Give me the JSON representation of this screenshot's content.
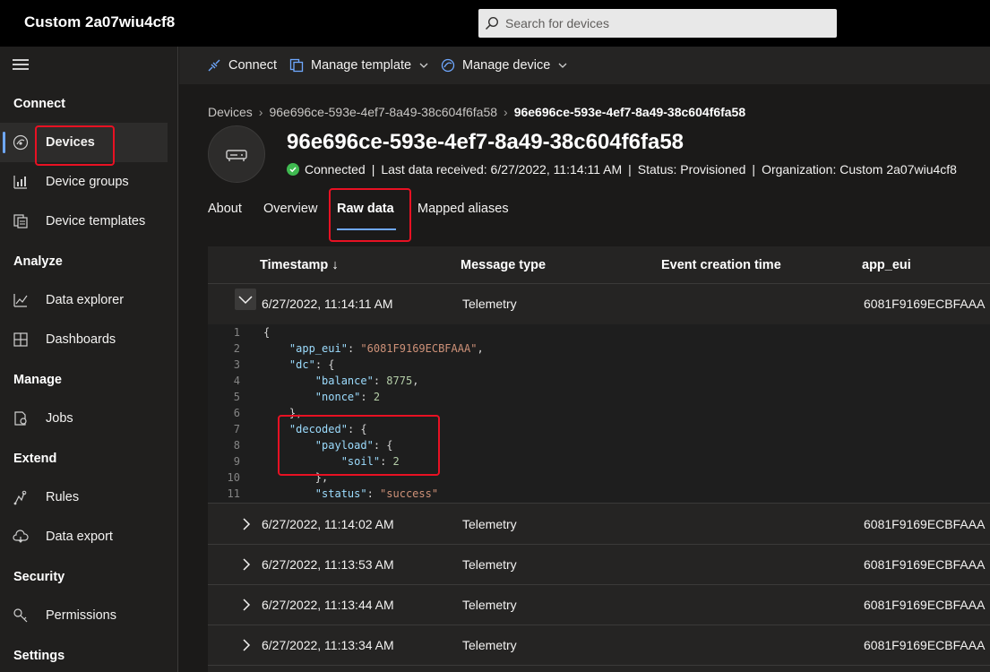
{
  "app": {
    "title": "Custom 2a07wiu4cf8"
  },
  "search": {
    "placeholder": "Search for devices"
  },
  "sidebar": {
    "sections": [
      {
        "label": "Connect"
      },
      {
        "label": "Analyze"
      },
      {
        "label": "Manage"
      },
      {
        "label": "Extend"
      },
      {
        "label": "Security"
      },
      {
        "label": "Settings"
      }
    ],
    "items": [
      {
        "label": "Devices"
      },
      {
        "label": "Device groups"
      },
      {
        "label": "Device templates"
      },
      {
        "label": "Data explorer"
      },
      {
        "label": "Dashboards"
      },
      {
        "label": "Jobs"
      },
      {
        "label": "Rules"
      },
      {
        "label": "Data export"
      },
      {
        "label": "Permissions"
      }
    ]
  },
  "commands": {
    "connect": "Connect",
    "manage_template": "Manage template",
    "manage_device": "Manage device"
  },
  "breadcrumb": {
    "root": "Devices",
    "parent": "96e696ce-593e-4ef7-8a49-38c604f6fa58",
    "current": "96e696ce-593e-4ef7-8a49-38c604f6fa58"
  },
  "device": {
    "title": "96e696ce-593e-4ef7-8a49-38c604f6fa58",
    "connection": "Connected",
    "last_data": "Last data received: 6/27/2022, 11:14:11 AM",
    "status": "Status: Provisioned",
    "organization": "Organization: Custom 2a07wiu4cf8"
  },
  "tabs": [
    {
      "label": "About"
    },
    {
      "label": "Overview"
    },
    {
      "label": "Raw data"
    },
    {
      "label": "Mapped aliases"
    }
  ],
  "table": {
    "columns": [
      "Timestamp ↓",
      "Message type",
      "Event creation time",
      "app_eui"
    ],
    "expanded_row": {
      "timestamp": "6/27/2022, 11:14:11 AM",
      "message_type": "Telemetry",
      "app_eui": "6081F9169ECBFAAA"
    },
    "rows": [
      {
        "timestamp": "6/27/2022, 11:14:02 AM",
        "message_type": "Telemetry",
        "app_eui": "6081F9169ECBFAAA"
      },
      {
        "timestamp": "6/27/2022, 11:13:53 AM",
        "message_type": "Telemetry",
        "app_eui": "6081F9169ECBFAAA"
      },
      {
        "timestamp": "6/27/2022, 11:13:44 AM",
        "message_type": "Telemetry",
        "app_eui": "6081F9169ECBFAAA"
      },
      {
        "timestamp": "6/27/2022, 11:13:34 AM",
        "message_type": "Telemetry",
        "app_eui": "6081F9169ECBFAAA"
      }
    ]
  },
  "code": {
    "line_numbers": [
      "1",
      "2",
      "3",
      "4",
      "5",
      "6",
      "7",
      "8",
      "9",
      "10",
      "11"
    ],
    "tokens": {
      "open_brace": "{",
      "app_eui_key": "\"app_eui\"",
      "app_eui_val": "\"6081F9169ECBFAAA\"",
      "dc_key": "\"dc\"",
      "balance_key": "\"balance\"",
      "balance_val": "8775",
      "nonce_key": "\"nonce\"",
      "nonce_val": "2",
      "close_obj": "},",
      "decoded_key": "\"decoded\"",
      "payload_key": "\"payload\"",
      "soil_key": "\"soil\"",
      "soil_val": "2",
      "status_key": "\"status\"",
      "status_val": "\"success\""
    }
  },
  "colors": {
    "accent": "#6fa8ff",
    "highlight": "#e81123",
    "connected": "#3fb950"
  }
}
